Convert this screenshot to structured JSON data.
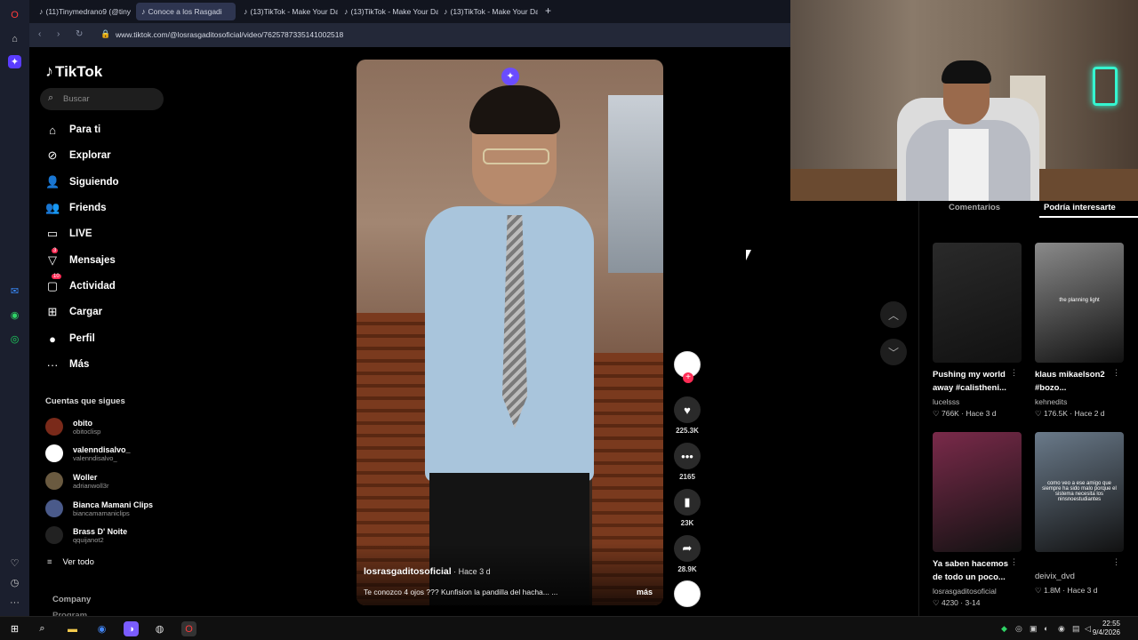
{
  "browser": {
    "tabs": [
      {
        "label": "(11)Tinymedrano9 (@tiny"
      },
      {
        "label": "Conoce a los Rasgadi"
      },
      {
        "label": "(13)TikTok - Make Your Da"
      },
      {
        "label": "(13)TikTok - Make Your Da"
      },
      {
        "label": "(13)TikTok - Make Your Da"
      }
    ],
    "new_tab": "+",
    "url": "www.tiktok.com/@losrasgaditosoficial/video/7625787335141002518"
  },
  "sidebar": {
    "logo": "TikTok",
    "search_placeholder": "Buscar",
    "nav": [
      {
        "label": "Para ti",
        "icon": "home-icon",
        "glyph": "⌂"
      },
      {
        "label": "Explorar",
        "icon": "compass-icon",
        "glyph": "⊘"
      },
      {
        "label": "Siguiendo",
        "icon": "following-icon",
        "glyph": "👤"
      },
      {
        "label": "Friends",
        "icon": "friends-icon",
        "glyph": "👥"
      },
      {
        "label": "LIVE",
        "icon": "live-icon",
        "glyph": "▭"
      },
      {
        "label": "Mensajes",
        "icon": "messages-icon",
        "glyph": "▽",
        "badge": "3"
      },
      {
        "label": "Actividad",
        "icon": "activity-icon",
        "glyph": "▢",
        "badge": "10"
      },
      {
        "label": "Cargar",
        "icon": "upload-icon",
        "glyph": "⊞"
      },
      {
        "label": "Perfil",
        "icon": "profile-icon",
        "glyph": "●"
      },
      {
        "label": "Más",
        "icon": "more-icon",
        "glyph": "···"
      }
    ],
    "following_title": "Cuentas que sigues",
    "accounts": [
      {
        "name": "obito",
        "handle": "obitoclisp",
        "color": "#7a2a1a"
      },
      {
        "name": "valenndisalvo_",
        "handle": "valenndisalvo_",
        "color": "#ffffff"
      },
      {
        "name": "Woller",
        "handle": "adrianwoll3r",
        "color": "#6a5a40"
      },
      {
        "name": "Bianca Mamani Clips",
        "handle": "biancamamaniclips",
        "color": "#4a5a8a"
      },
      {
        "name": "Brass D' Noite",
        "handle": "qquijanot2",
        "color": "#222222"
      }
    ],
    "see_all": "Ver todo",
    "company": "Company",
    "program": "Program"
  },
  "video": {
    "author": "losrasgaditosoficial",
    "ago": " · Hace 3 d",
    "caption": "Te conozco 4 ojos ??? Kunfision la pandilla del hacha... ...",
    "more": "más"
  },
  "actions": {
    "likes": "225.3K",
    "comments": "2165",
    "saves": "23K",
    "shares": "28.9K"
  },
  "right_panel": {
    "tab_comments": "Comentarios",
    "tab_interest": "Podría interesarte",
    "cards": [
      {
        "title": "Pushing my world away #calistheni...",
        "user": "lucelsss",
        "views": "766K",
        "ago": "Hace 3 d",
        "bg": "#2a2a2a",
        "overlay": ""
      },
      {
        "title": "klaus mikaelson2 #bozo...",
        "user": "kehnedits",
        "views": "176.5K",
        "ago": "Hace 2 d",
        "bg": "#8a8a8a",
        "overlay": "the planning light"
      },
      {
        "title": "Ya saben hacemos de todo un poco...",
        "user": "losrasgaditosoficial",
        "views": "4230",
        "ago": "3-14",
        "bg": "#7a2a4a",
        "overlay": ""
      },
      {
        "title": "deivix_dvd",
        "user": "",
        "views": "1.8M",
        "ago": "Hace 3 d",
        "bg": "#6a7a8a",
        "overlay": "como veo a ese amigo que siempre ha sido malo porque el sistema necesita los ninsnoestudiantes"
      }
    ]
  },
  "taskbar": {
    "time": "22:55",
    "date": "9/4/2026"
  }
}
